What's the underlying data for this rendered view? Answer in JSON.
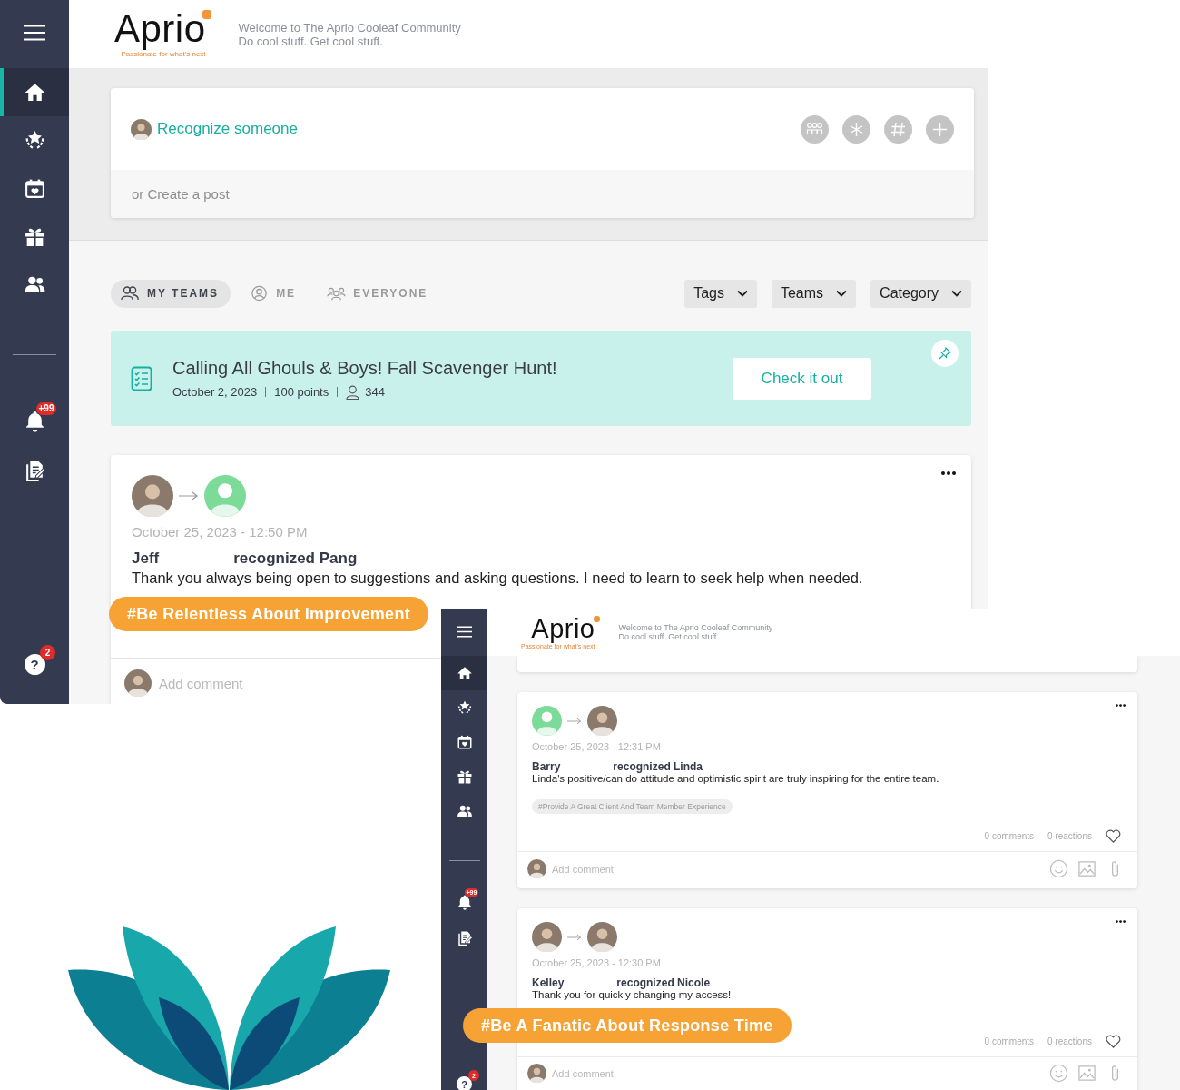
{
  "main_window": {
    "sidebar": {
      "items": [
        {
          "kind": "home",
          "selected": true
        },
        {
          "kind": "awards",
          "selected": false
        },
        {
          "kind": "calendar",
          "selected": false
        },
        {
          "kind": "gift",
          "selected": false
        },
        {
          "kind": "people",
          "selected": false
        }
      ],
      "notifications_badge": "+99",
      "help_label": "?",
      "help_badge": "2"
    },
    "header": {
      "logo": "Aprio",
      "tagline": "Passionate for what's next",
      "welcome": "Welcome to The Aprio Cooleaf Community",
      "subtitle": "Do cool stuff. Get cool stuff."
    },
    "composer": {
      "recognize": "Recognize someone",
      "create_post": "or Create a post"
    },
    "feed_tabs": [
      {
        "kind": "teams",
        "label": "MY TEAMS",
        "selected": true
      },
      {
        "kind": "me",
        "label": "ME",
        "selected": false
      },
      {
        "kind": "everyone",
        "label": "EVERYONE",
        "selected": false
      }
    ],
    "filters": [
      "Tags",
      "Teams",
      "Category"
    ],
    "event": {
      "title": "Calling All Ghouls & Boys! Fall Scavenger Hunt!",
      "date": "October 2, 2023",
      "points": "100 points",
      "participants": "344",
      "button": "Check it out"
    },
    "posts": [
      {
        "avatars": [
          {
            "kind": "photo"
          },
          {
            "kind": "default"
          }
        ],
        "date": "October 25, 2023 - 12:50 PM",
        "giver": "Jeff",
        "action": "recognized Pang",
        "message": "Thank you always being open to suggestions and asking questions. I need to learn to seek help when needed.",
        "comment_placeholder": "Add comment"
      }
    ]
  },
  "inset_window": {
    "sidebar": {
      "items": [
        {
          "kind": "home",
          "selected": true
        },
        {
          "kind": "awards",
          "selected": false
        },
        {
          "kind": "calendar",
          "selected": false
        },
        {
          "kind": "gift",
          "selected": false
        },
        {
          "kind": "people",
          "selected": false
        }
      ],
      "notifications_badge": "+99",
      "help_label": "?",
      "help_badge": "2"
    },
    "header": {
      "logo": "Aprio",
      "tagline": "Passionate for what's next",
      "welcome": "Welcome to The Aprio Cooleaf Community",
      "subtitle": "Do cool stuff. Get cool stuff."
    },
    "posts": [
      {
        "avatars": [
          {
            "kind": "default"
          },
          {
            "kind": "photo"
          }
        ],
        "date": "October 25, 2023 - 12:31 PM",
        "giver": "Barry",
        "action": "recognized Linda",
        "message": "Linda's positive/can do attitude and optimistic spirit are truly inspiring for the entire team.",
        "tag": "#Provide A Great Client And Team Member Experience",
        "comments": "0 comments",
        "reactions": "0 reactions",
        "comment_placeholder": "Add comment"
      },
      {
        "avatars": [
          {
            "kind": "photo"
          },
          {
            "kind": "photo"
          }
        ],
        "date": "October 25, 2023 - 12:30 PM",
        "giver": "Kelley",
        "action": "recognized Nicole",
        "message": "Thank you for quickly changing my access!",
        "comments": "0 comments",
        "reactions": "0 reactions",
        "comment_placeholder": "Add comment"
      }
    ]
  },
  "highlight_tags": [
    "#Be Relentless About Improvement",
    "#Be A Fanatic About Response Time"
  ]
}
